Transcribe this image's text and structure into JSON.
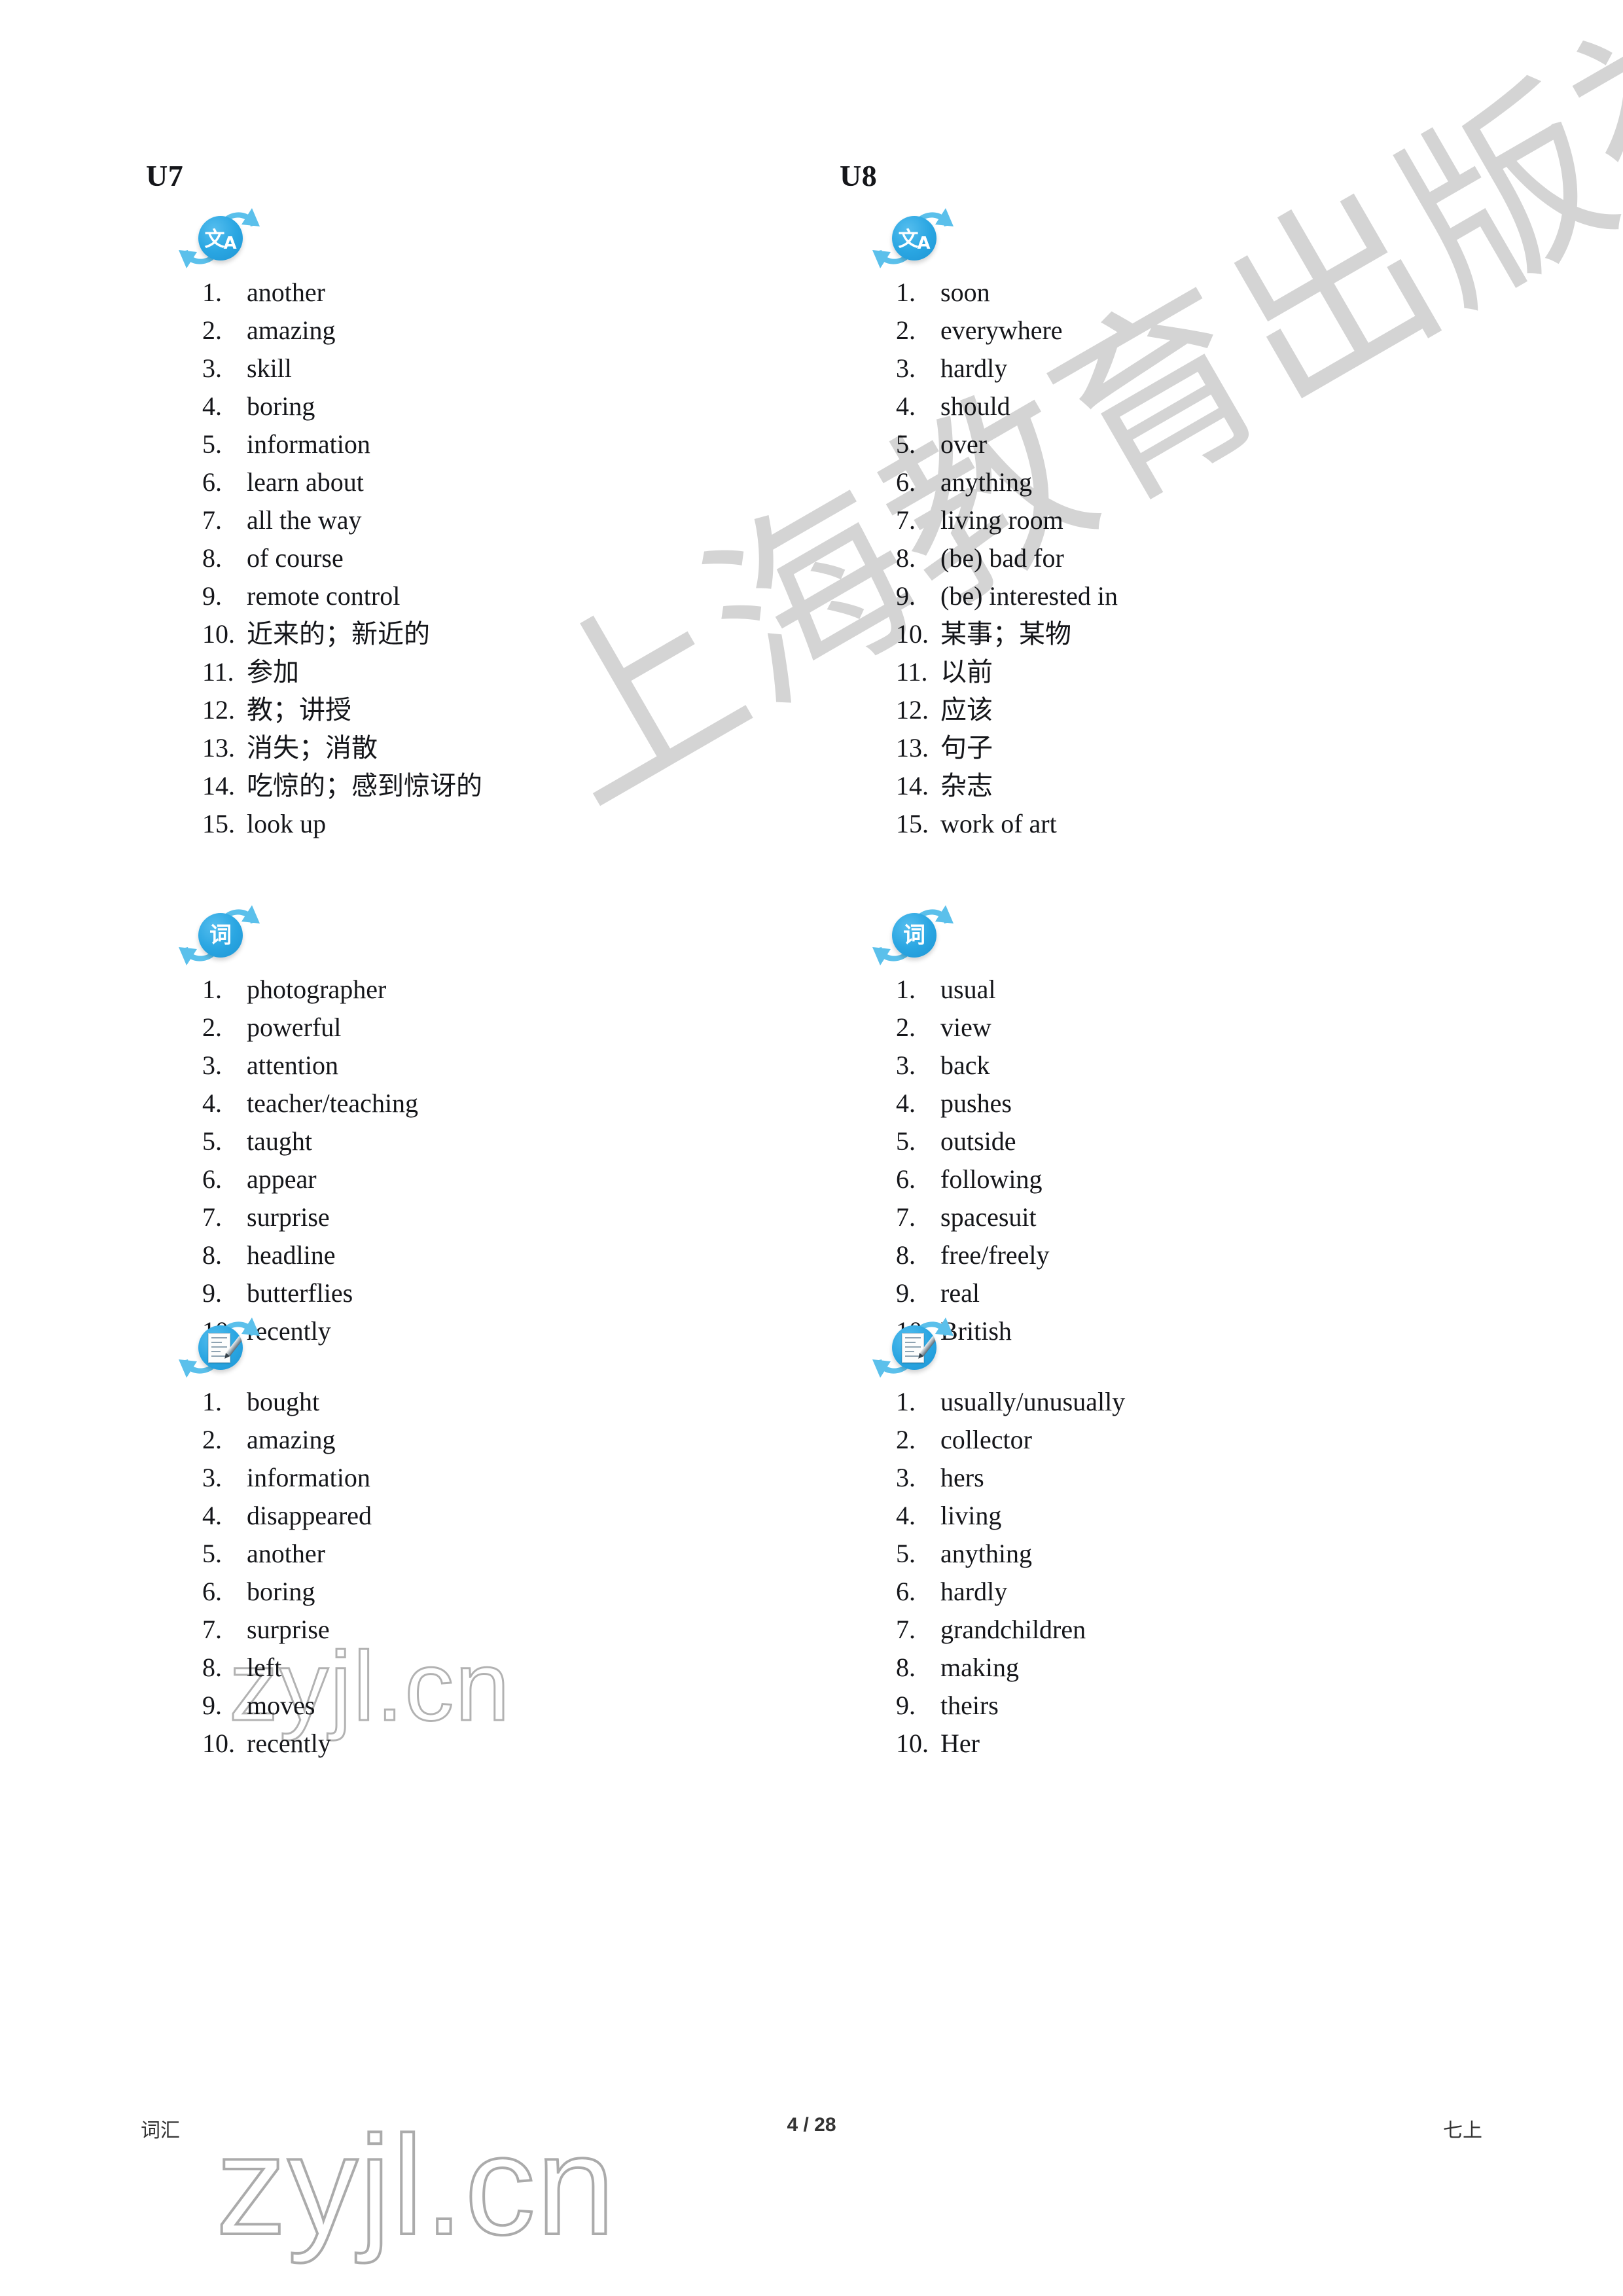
{
  "page": {
    "footer_left": "词汇",
    "footer_center": "4 / 28",
    "footer_right": "七上"
  },
  "watermarks": {
    "publisher": "上海教育出版社",
    "url_middle": "zyjl.cn",
    "url_bottom": "zyjl.cn"
  },
  "icons": {
    "translate": {
      "glyph_big": "文",
      "glyph_small": "A",
      "name": "translate-icon"
    },
    "word": {
      "glyph": "词",
      "name": "word-icon"
    },
    "writing": {
      "name": "notepad-pencil-icon"
    }
  },
  "colors": {
    "icon_blue": "#2AA6E2",
    "icon_blue_light": "#5BC0EB",
    "watermark_gray": "#BFBFBF"
  },
  "columns": [
    {
      "unit": "U7",
      "sections": [
        {
          "icon": "translate",
          "items": [
            "1. another",
            "2. amazing",
            "3. skill",
            "4. boring",
            "5. information",
            "6. learn about",
            "7. all the way",
            "8. of course",
            "9. remote control",
            "10. 近来的；新近的",
            "11. 参加",
            "12. 教；讲授",
            "13. 消失；消散",
            "14. 吃惊的；感到惊讶的",
            "15. look up"
          ]
        },
        {
          "icon": "word",
          "items": [
            "1. photographer",
            "2. powerful",
            "3. attention",
            "4. teacher/teaching",
            "5. taught",
            "6. appear",
            "7. surprise",
            "8. headline",
            "9. butterflies",
            "10. recently"
          ]
        },
        {
          "icon": "writing",
          "items": [
            "1. bought",
            "2. amazing",
            "3. information",
            "4. disappeared",
            "5. another",
            "6. boring",
            "7. surprise",
            "8. left",
            "9. moves",
            "10. recently"
          ]
        }
      ]
    },
    {
      "unit": "U8",
      "sections": [
        {
          "icon": "translate",
          "items": [
            "1. soon",
            "2. everywhere",
            "3. hardly",
            "4. should",
            "5. over",
            "6. anything",
            "7. living room",
            "8. (be) bad for",
            "9. (be) interested in",
            "10. 某事；某物",
            "11. 以前",
            "12. 应该",
            "13. 句子",
            "14. 杂志",
            "15. work of art"
          ]
        },
        {
          "icon": "word",
          "items": [
            "1. usual",
            "2. view",
            "3. back",
            "4. pushes",
            "5. outside",
            "6. following",
            "7. spacesuit",
            "8. free/freely",
            "9. real",
            "10. British"
          ]
        },
        {
          "icon": "writing",
          "items": [
            "1. usually/unusually",
            "2. collector",
            "3. hers",
            "4. living",
            "5. anything",
            "6. hardly",
            "7. grandchildren",
            "8. making",
            "9. theirs",
            "10. Her"
          ]
        }
      ]
    }
  ]
}
